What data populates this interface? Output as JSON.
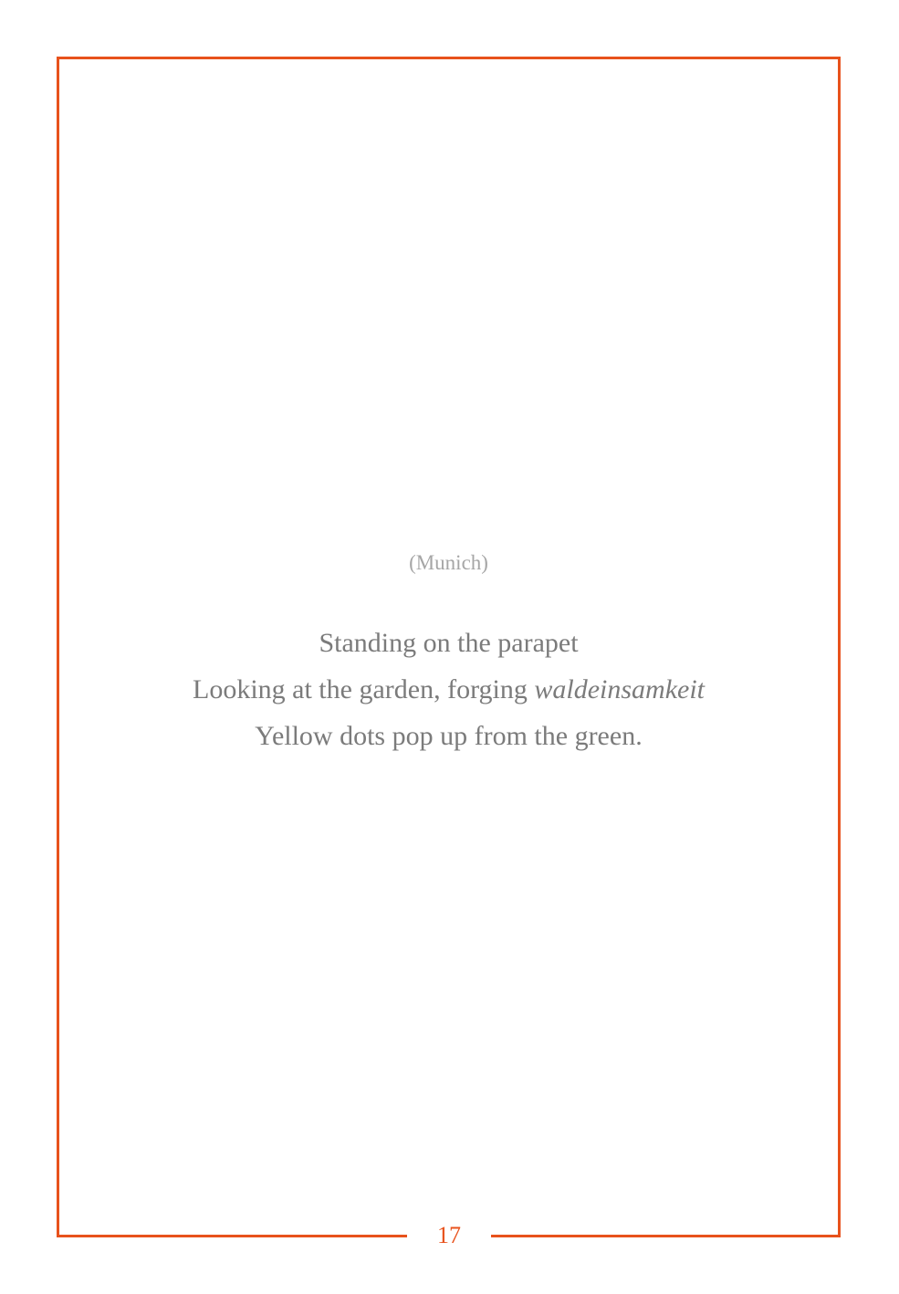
{
  "poem": {
    "place": "(Munich)",
    "line1": "Standing on the parapet",
    "line2_text": "Looking at the garden, forging",
    "line2_italic": "waldeinsamkeit",
    "line3": "Yellow dots pop up from the green."
  },
  "page": {
    "number": "17",
    "accent_color": "#e8521c"
  }
}
